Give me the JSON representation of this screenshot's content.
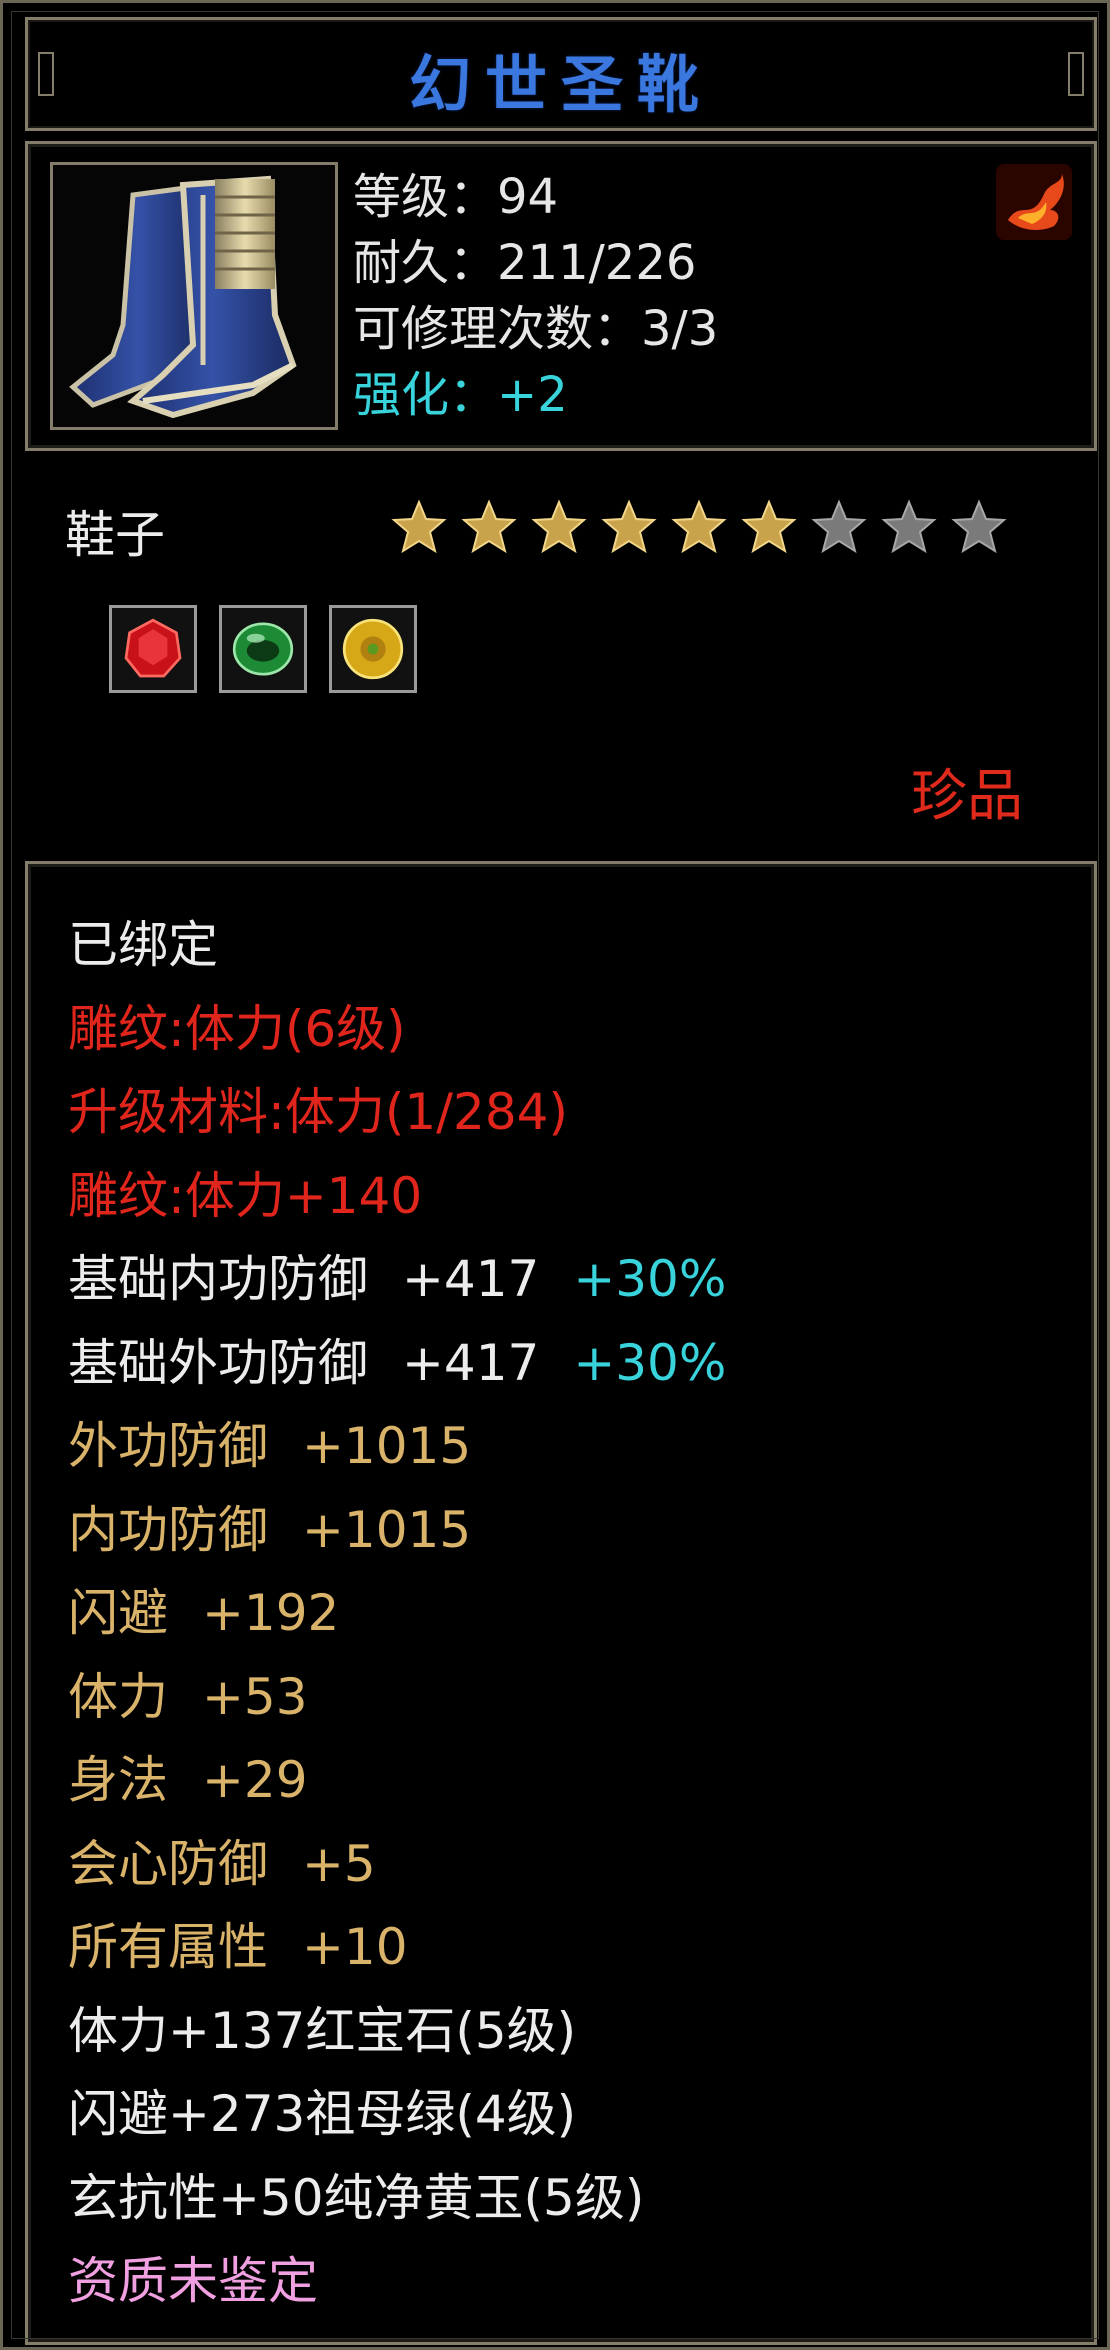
{
  "title": "幻世圣靴",
  "header": {
    "level_label": "等级：94",
    "durability_label": "耐久：211/226",
    "repair_label": "可修理次数：3/3",
    "enhance_label": "强化：+2"
  },
  "item_type": "鞋子",
  "stars": {
    "filled": 6,
    "total": 9
  },
  "gems": [
    {
      "name": "ruby-icon",
      "color": "#d81a1a"
    },
    {
      "name": "emerald-icon",
      "color": "#1f9a3a"
    },
    {
      "name": "yellow-jade-icon",
      "color": "#d8b420"
    }
  ],
  "rarity": "珍品",
  "properties": [
    {
      "text": "已绑定",
      "color": "white"
    },
    {
      "text": "雕纹:体力(6级)",
      "color": "red"
    },
    {
      "text": "升级材料:体力(1/284)",
      "color": "red"
    },
    {
      "text": "雕纹:体力+140",
      "color": "red"
    },
    {
      "text": "基础内功防御",
      "value": "+417",
      "extra": "+30%",
      "color": "white"
    },
    {
      "text": "基础外功防御",
      "value": "+417",
      "extra": "+30%",
      "color": "white"
    },
    {
      "text": "外功防御",
      "value": "+1015",
      "color": "gold"
    },
    {
      "text": "内功防御",
      "value": "+1015",
      "color": "gold"
    },
    {
      "text": "闪避",
      "value": "+192",
      "color": "gold"
    },
    {
      "text": "体力",
      "value": "+53",
      "color": "gold"
    },
    {
      "text": "身法",
      "value": "+29",
      "color": "gold"
    },
    {
      "text": "会心防御",
      "value": "+5",
      "color": "gold"
    },
    {
      "text": "所有属性",
      "value": "+10",
      "color": "gold"
    },
    {
      "text": "体力+137红宝石(5级)",
      "color": "white"
    },
    {
      "text": "闪避+273祖母绿(4级)",
      "color": "white"
    },
    {
      "text": "玄抗性+50纯净黄玉(5级)",
      "color": "white"
    },
    {
      "text": "资质未鉴定",
      "color": "pink"
    }
  ]
}
